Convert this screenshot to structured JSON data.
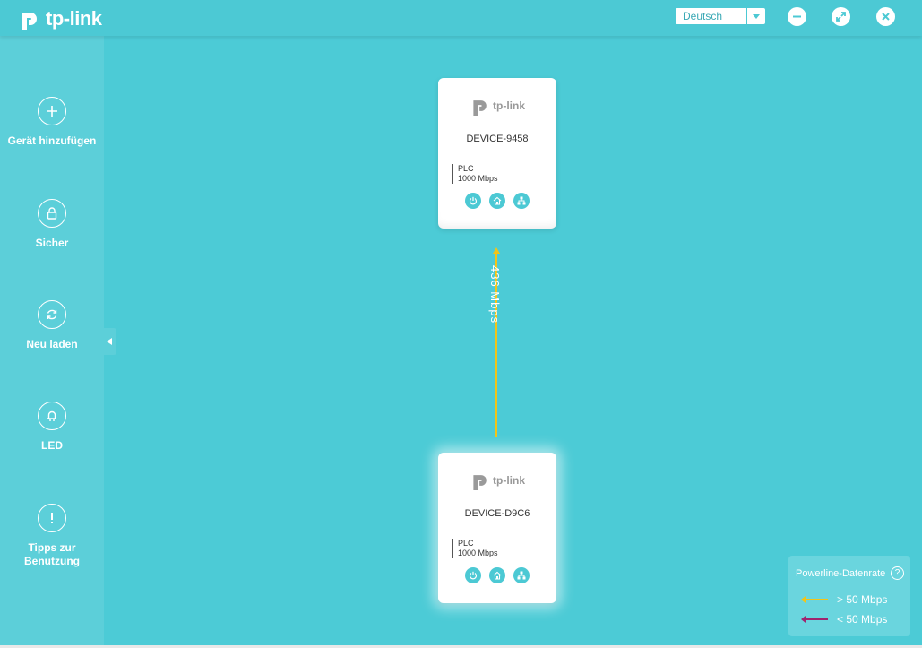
{
  "brand": {
    "name": "tp-link"
  },
  "header": {
    "language": {
      "selected": "Deutsch"
    },
    "buttons": [
      "minimize",
      "restore",
      "close"
    ]
  },
  "sidebar": {
    "items": [
      {
        "label": "Gerät hinzufügen",
        "icon": "plus-icon"
      },
      {
        "label": "Sicher",
        "icon": "lock-icon"
      },
      {
        "label": "Neu laden",
        "icon": "refresh-icon"
      },
      {
        "label": "LED",
        "icon": "led-icon"
      },
      {
        "label": "Tipps zur Benutzung",
        "icon": "info-icon"
      }
    ]
  },
  "devices": [
    {
      "logo": "tp-link",
      "name": "DEVICE-9458",
      "type": "PLC",
      "speed": "1000 Mbps"
    },
    {
      "logo": "tp-link",
      "name": "DEVICE-D9C6",
      "type": "PLC",
      "speed": "1000 Mbps"
    }
  ],
  "link": {
    "rate": "436 Mbps",
    "color": "#f2c417"
  },
  "legend": {
    "title": "Powerline-Datenrate",
    "rows": [
      {
        "label": "> 50 Mbps",
        "color": "#f2c417"
      },
      {
        "label": "< 50 Mbps",
        "color": "#a0246e"
      }
    ]
  },
  "colors": {
    "accent": "#4cc9d4",
    "sidebar": "#5ccfd9"
  }
}
